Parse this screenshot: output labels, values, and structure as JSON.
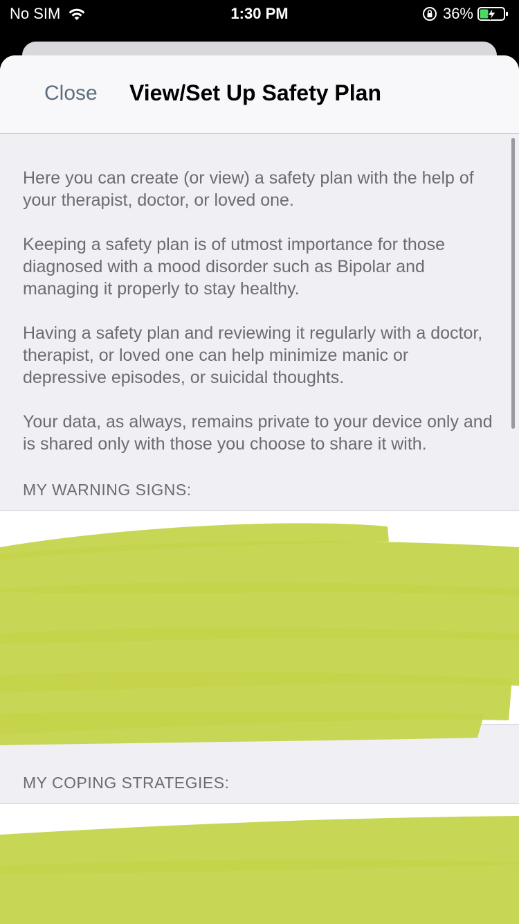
{
  "status_bar": {
    "carrier": "No SIM",
    "time": "1:30 PM",
    "battery_percent": "36%"
  },
  "nav": {
    "close_label": "Close",
    "title": "View/Set Up Safety Plan"
  },
  "intro": {
    "paragraphs": [
      "Here you can create (or view) a safety plan with the help of your therapist, doctor, or loved one.",
      "Keeping a safety plan is of utmost importance for those diagnosed with a mood disorder such as Bipolar and managing it properly to stay healthy.",
      "Having a safety plan and reviewing it regularly with a doctor, therapist, or loved one can help minimize manic or depressive episodes, or suicidal thoughts.",
      "Your data, as always, remains private to your device only and is shared only with those you choose to share it with."
    ]
  },
  "sections": {
    "warning_header": "MY WARNING SIGNS:",
    "warning_text": "",
    "coping_header": "MY COPING STRATEGIES:",
    "coping_text": ""
  },
  "colors": {
    "redaction": "#c5d34a"
  }
}
